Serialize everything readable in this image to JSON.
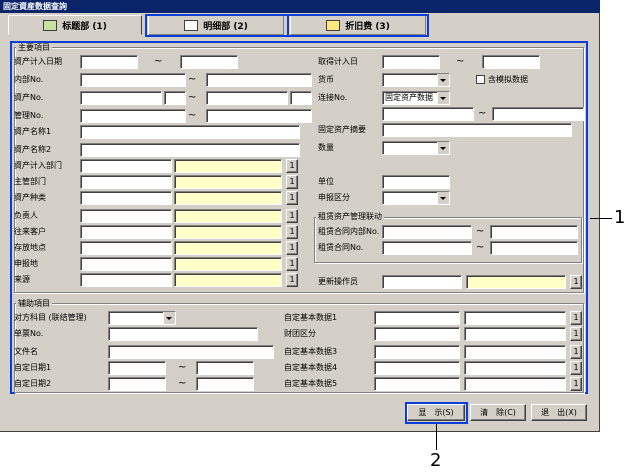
{
  "window": {
    "title": "固定資産数据查詢"
  },
  "tabs": [
    {
      "label": "标题部 (1)",
      "icon": "book-icon"
    },
    {
      "label": "明细部 (2)",
      "icon": "document-icon"
    },
    {
      "label": "折旧费 (3)",
      "icon": "card-icon"
    }
  ],
  "main": {
    "title": "主要項目",
    "left": {
      "asset_date": "資产计入日期",
      "dept_no": "内部No.",
      "asset_no": "資产No.",
      "mgmt_no": "管理No.",
      "asset_name1": "資产名称1",
      "asset_name2": "資产名称2",
      "asset_dept": "資产计入部门",
      "owner_dept": "主管部门",
      "asset_type": "資产种类",
      "manager": "负责人",
      "customer": "往来客户",
      "location": "存放地点",
      "report_place": "申报地",
      "source": "来源"
    },
    "right": {
      "acquire_date": "取得计入日",
      "currency": "货币",
      "include_mock": "含模拟数据",
      "link_no": "连接No.",
      "link_value": "固定资产数据",
      "asset_summary": "固定资产摘要",
      "quantity": "数量",
      "unit": "单位",
      "report_class": "申报区分",
      "lease_group": "租赁资产管理联动",
      "lease_dept_no": "租赁合同内部No.",
      "lease_no": "租赁合同No.",
      "updater": "更新操作员"
    }
  },
  "aux": {
    "title": "辅助項目",
    "counter_subject": "对方科目 (联结管理)",
    "slip_no": "单票No.",
    "file_name": "文件名",
    "custom_date1": "自定日期1",
    "custom_date2": "自定日期2",
    "custom_basic1": "自定基本数据1",
    "fund_class": "财团区分",
    "custom_basic3": "自定基本数据3",
    "custom_basic4": "自定基本数据4",
    "custom_basic5": "自定基本数据5"
  },
  "buttons": {
    "display": "显　示(S)",
    "clear": "清　除(C)",
    "exit": "退　出(X)"
  },
  "lookup_label": "1",
  "tilde": "~",
  "callouts": {
    "one": "1",
    "two": "2"
  }
}
